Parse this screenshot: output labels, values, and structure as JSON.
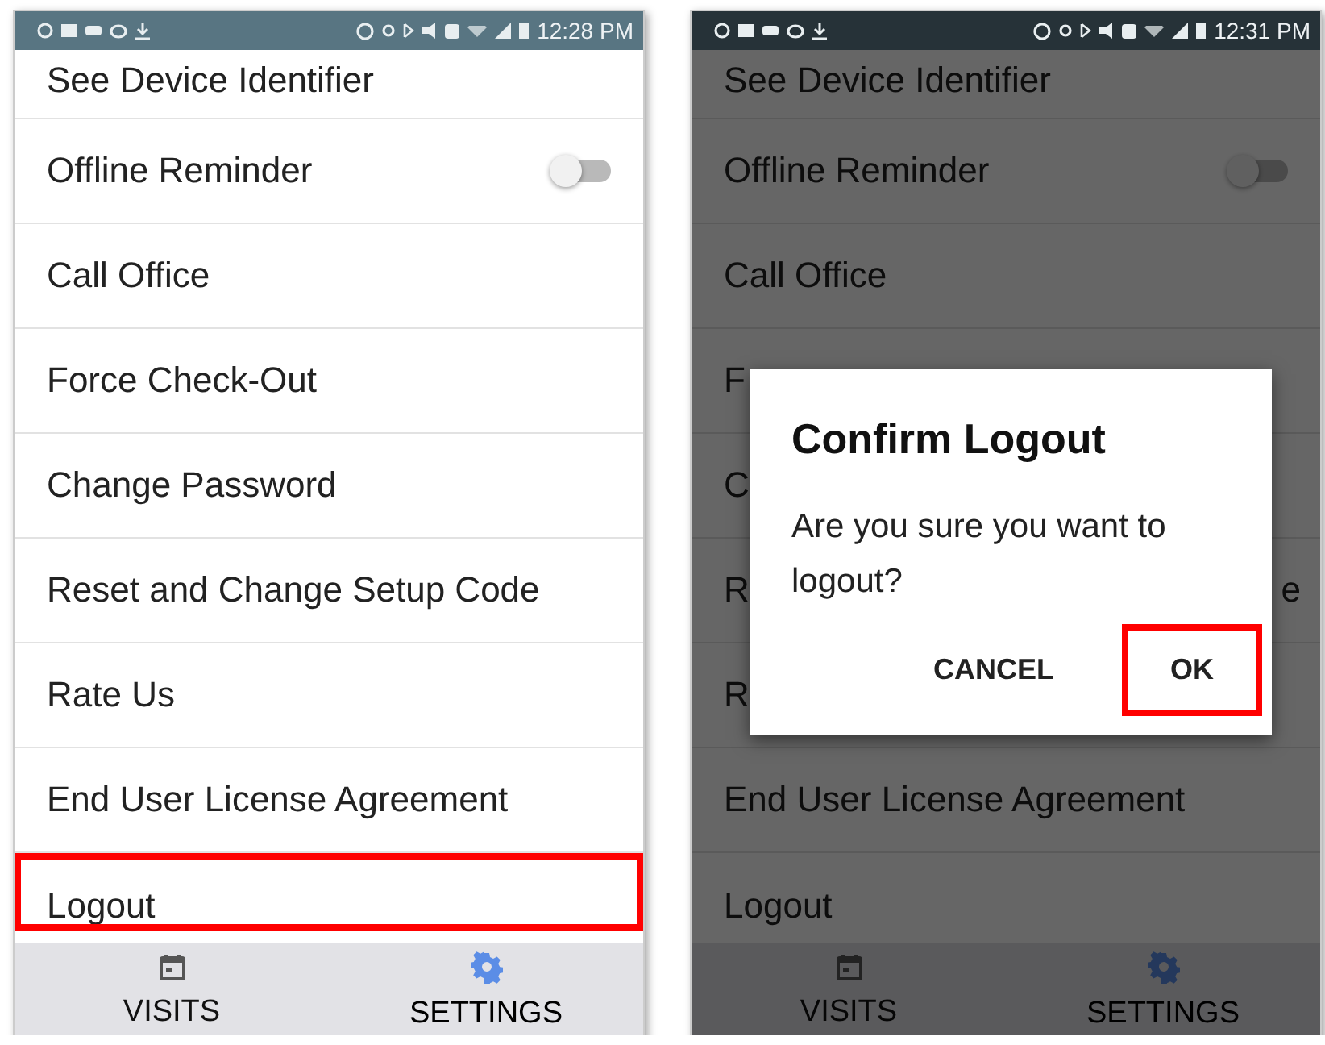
{
  "screens": [
    {
      "status_time": "12:28 PM",
      "items": [
        {
          "kind": "link",
          "label": "See Device Identifier",
          "highlighted": false
        },
        {
          "kind": "toggle",
          "label": "Offline Reminder",
          "on": false,
          "highlighted": false
        },
        {
          "kind": "link",
          "label": "Call Office",
          "highlighted": false
        },
        {
          "kind": "link",
          "label": "Force Check-Out",
          "highlighted": false
        },
        {
          "kind": "link",
          "label": "Change Password",
          "highlighted": false
        },
        {
          "kind": "link",
          "label": "Reset and Change Setup Code",
          "highlighted": false
        },
        {
          "kind": "link",
          "label": "Rate Us",
          "highlighted": false
        },
        {
          "kind": "link",
          "label": "End User License Agreement",
          "highlighted": false
        },
        {
          "kind": "link",
          "label": "Logout",
          "highlighted": true
        }
      ],
      "nav": [
        {
          "kind": "visits",
          "label": "VISITS",
          "selected": false
        },
        {
          "kind": "settings",
          "label": "SETTINGS",
          "selected": true
        }
      ]
    },
    {
      "status_time": "12:31 PM",
      "items": [
        {
          "kind": "link",
          "label": "See Device Identifier",
          "highlighted": false
        },
        {
          "kind": "toggle",
          "label": "Offline Reminder",
          "on": false,
          "highlighted": false
        },
        {
          "kind": "link",
          "label": "Call Office",
          "highlighted": false
        },
        {
          "kind": "link",
          "label": "F",
          "highlighted": false
        },
        {
          "kind": "link",
          "label": "C",
          "highlighted": false
        },
        {
          "kind": "link",
          "label": "R",
          "label_end": "e",
          "highlighted": false
        },
        {
          "kind": "link",
          "label": "R",
          "highlighted": false
        },
        {
          "kind": "link",
          "label": "End User License Agreement",
          "highlighted": false
        },
        {
          "kind": "link",
          "label": "Logout",
          "highlighted": false
        }
      ],
      "nav": [
        {
          "kind": "visits",
          "label": "VISITS",
          "selected": false
        },
        {
          "kind": "settings",
          "label": "SETTINGS",
          "selected": true
        }
      ],
      "dialog": {
        "title": "Confirm Logout",
        "message": "Are you sure you want to logout?",
        "buttons": [
          {
            "label": "CANCEL",
            "highlighted": false
          },
          {
            "label": "OK",
            "highlighted": true
          }
        ]
      }
    }
  ]
}
